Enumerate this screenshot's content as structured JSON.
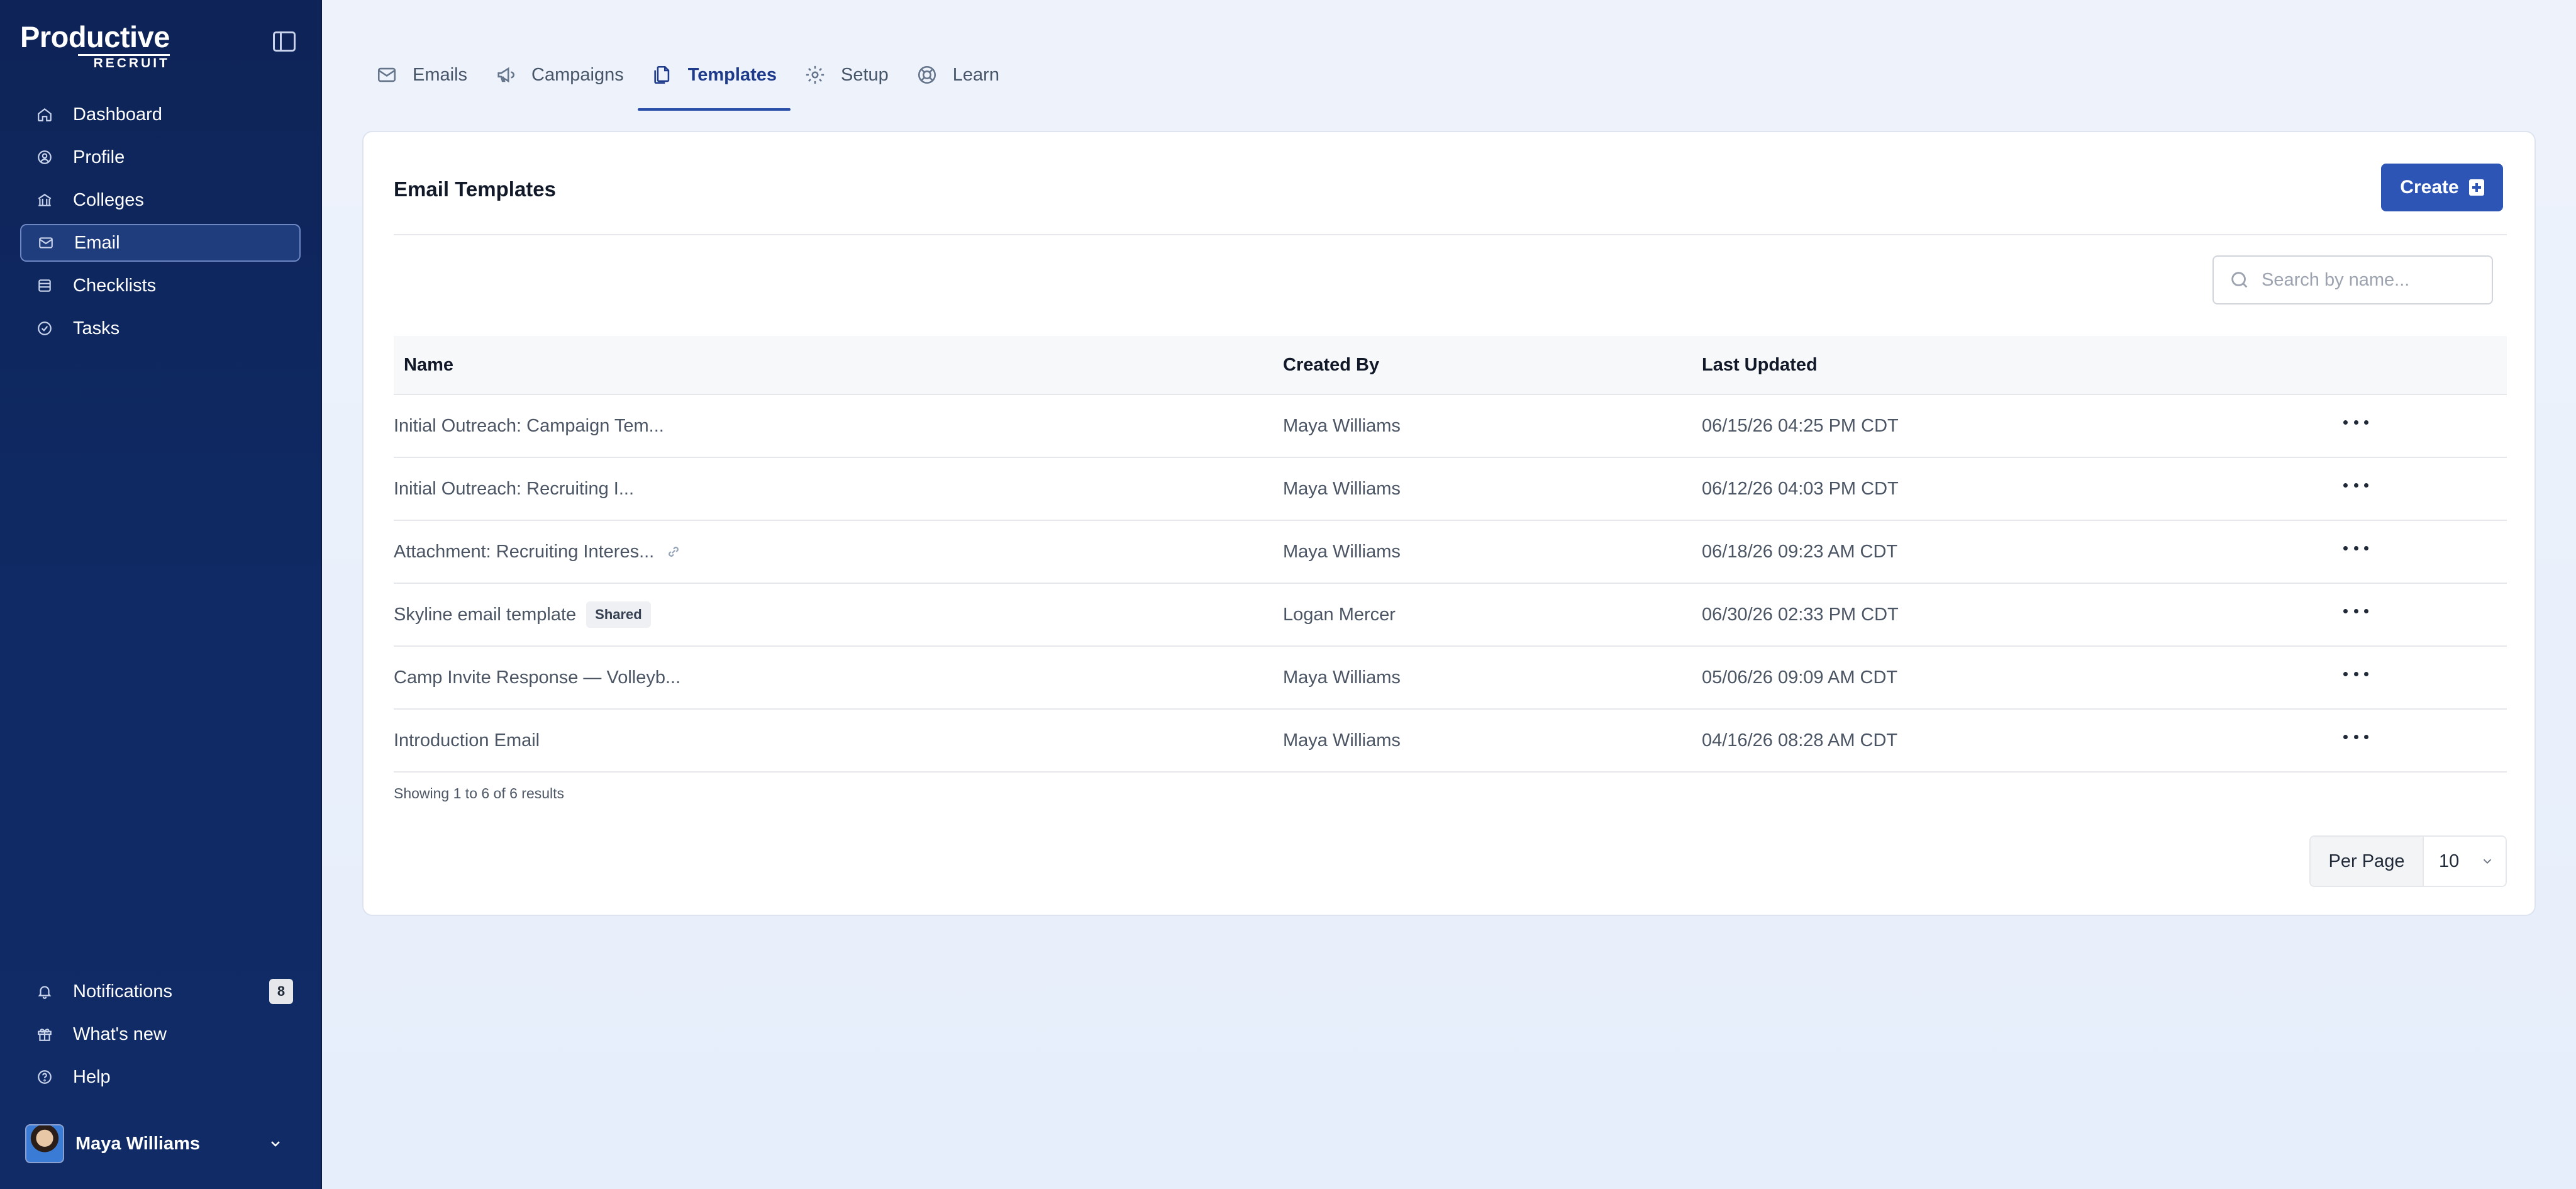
{
  "app": {
    "logo_main": "Productive",
    "logo_sub": "RECRUIT"
  },
  "sidebar": {
    "items": [
      {
        "label": "Dashboard",
        "icon": "home-icon"
      },
      {
        "label": "Profile",
        "icon": "user-circle-icon"
      },
      {
        "label": "Colleges",
        "icon": "building-icon"
      },
      {
        "label": "Email",
        "icon": "envelope-icon",
        "active": true
      },
      {
        "label": "Checklists",
        "icon": "list-icon"
      },
      {
        "label": "Tasks",
        "icon": "check-circle-icon"
      }
    ],
    "bottom": [
      {
        "label": "Notifications",
        "icon": "bell-icon",
        "count": "8"
      },
      {
        "label": "What's new",
        "icon": "gift-icon"
      },
      {
        "label": "Help",
        "icon": "help-circle-icon"
      }
    ],
    "user": {
      "name": "Maya Williams"
    }
  },
  "tabs": [
    {
      "label": "Emails",
      "icon": "envelope-icon"
    },
    {
      "label": "Campaigns",
      "icon": "megaphone-icon"
    },
    {
      "label": "Templates",
      "icon": "documents-icon",
      "active": true
    },
    {
      "label": "Setup",
      "icon": "gear-icon"
    },
    {
      "label": "Learn",
      "icon": "lifebuoy-icon"
    }
  ],
  "card": {
    "title": "Email Templates",
    "create_label": "Create",
    "search_placeholder": "Search by name..."
  },
  "table": {
    "headers": {
      "name": "Name",
      "created_by": "Created By",
      "last_updated": "Last Updated"
    },
    "rows": [
      {
        "name": "Initial Outreach: Campaign Tem...",
        "created_by": "Maya Williams",
        "last_updated": "06/15/26 04:25 PM CDT"
      },
      {
        "name": "Initial Outreach: Recruiting I...",
        "created_by": "Maya Williams",
        "last_updated": "06/12/26 04:03 PM CDT"
      },
      {
        "name": "Attachment: Recruiting Interes...",
        "created_by": "Maya Williams",
        "last_updated": "06/18/26 09:23 AM CDT",
        "has_attachment": true
      },
      {
        "name": "Skyline email template",
        "created_by": "Logan Mercer",
        "last_updated": "06/30/26 02:33 PM CDT",
        "badge": "Shared"
      },
      {
        "name": "Camp Invite Response — Volleyb...",
        "created_by": "Maya Williams",
        "last_updated": "05/06/26 09:09 AM CDT"
      },
      {
        "name": "Introduction Email",
        "created_by": "Maya Williams",
        "last_updated": "04/16/26 08:28 AM CDT"
      }
    ]
  },
  "footer": {
    "results_text": "Showing 1 to 6 of 6 results",
    "per_page_label": "Per Page",
    "per_page_value": "10"
  },
  "colors": {
    "sidebar_bg": "#0e2458",
    "accent": "#2d55b5",
    "active_tab": "#1e3a8a"
  }
}
